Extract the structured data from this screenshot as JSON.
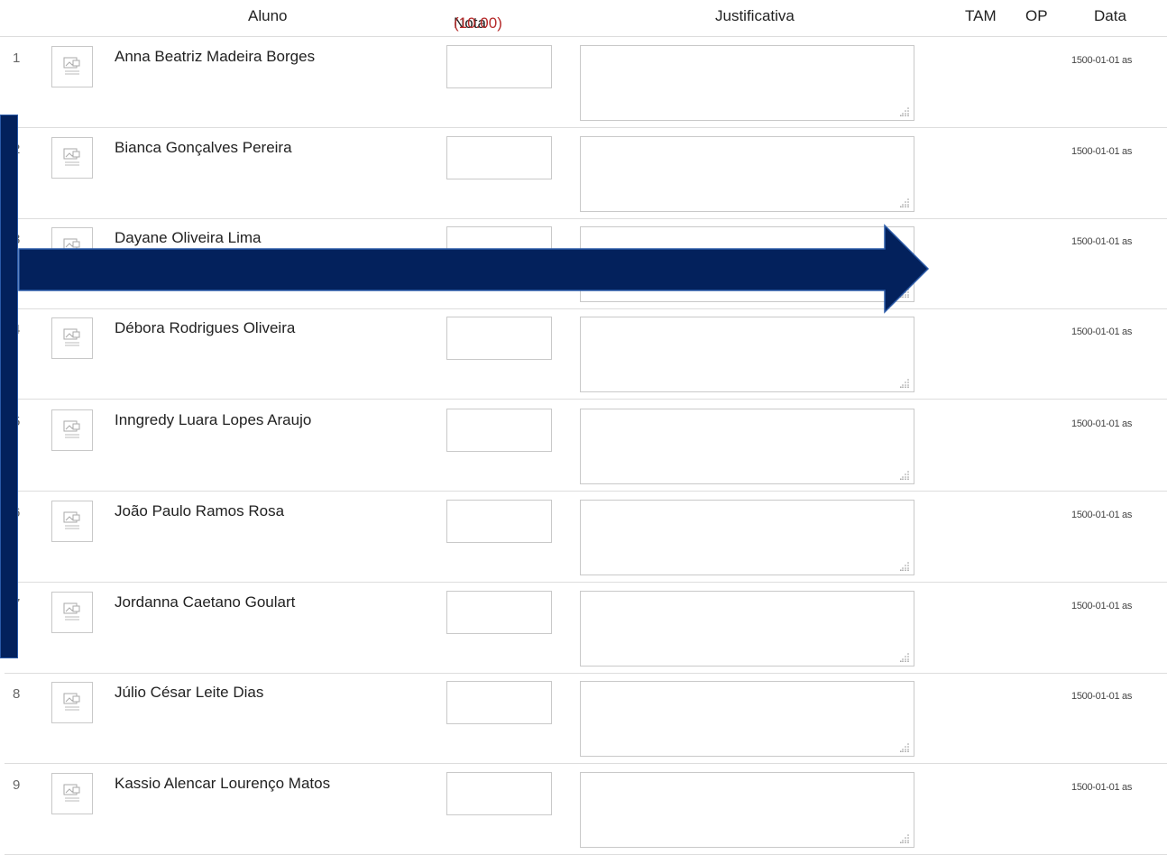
{
  "header": {
    "aluno": "Aluno",
    "nota_label": "Nota",
    "nota_max": "(10.00)",
    "justificativa": "Justificativa",
    "tam": "TAM",
    "op": "OP",
    "data": "Data"
  },
  "rows": [
    {
      "num": "1",
      "name": "Anna Beatriz Madeira Borges",
      "date": "1500-01-01 as"
    },
    {
      "num": "2",
      "name": "Bianca Gonçalves Pereira",
      "date": "1500-01-01 as"
    },
    {
      "num": "3",
      "name": "Dayane Oliveira Lima",
      "date": "1500-01-01 as"
    },
    {
      "num": "4",
      "name": "Débora Rodrigues Oliveira",
      "date": "1500-01-01 as"
    },
    {
      "num": "5",
      "name": "Inngredy Luara Lopes Araujo",
      "date": "1500-01-01 as"
    },
    {
      "num": "6",
      "name": "João Paulo Ramos Rosa",
      "date": "1500-01-01 as"
    },
    {
      "num": "7",
      "name": "Jordanna Caetano Goulart",
      "date": "1500-01-01 as"
    },
    {
      "num": "8",
      "name": "Júlio César Leite Dias",
      "date": "1500-01-01 as"
    },
    {
      "num": "9",
      "name": "Kassio Alencar Lourenço Matos",
      "date": "1500-01-01 as"
    }
  ],
  "colors": {
    "overlay_fill": "#03215c",
    "overlay_border": "#2a5aa8",
    "max_grade": "#b52a2a"
  },
  "icons": {
    "avatar": "image-placeholder-icon",
    "resize": "resize-grip-icon",
    "overlay": "arrow-right-overlay"
  }
}
